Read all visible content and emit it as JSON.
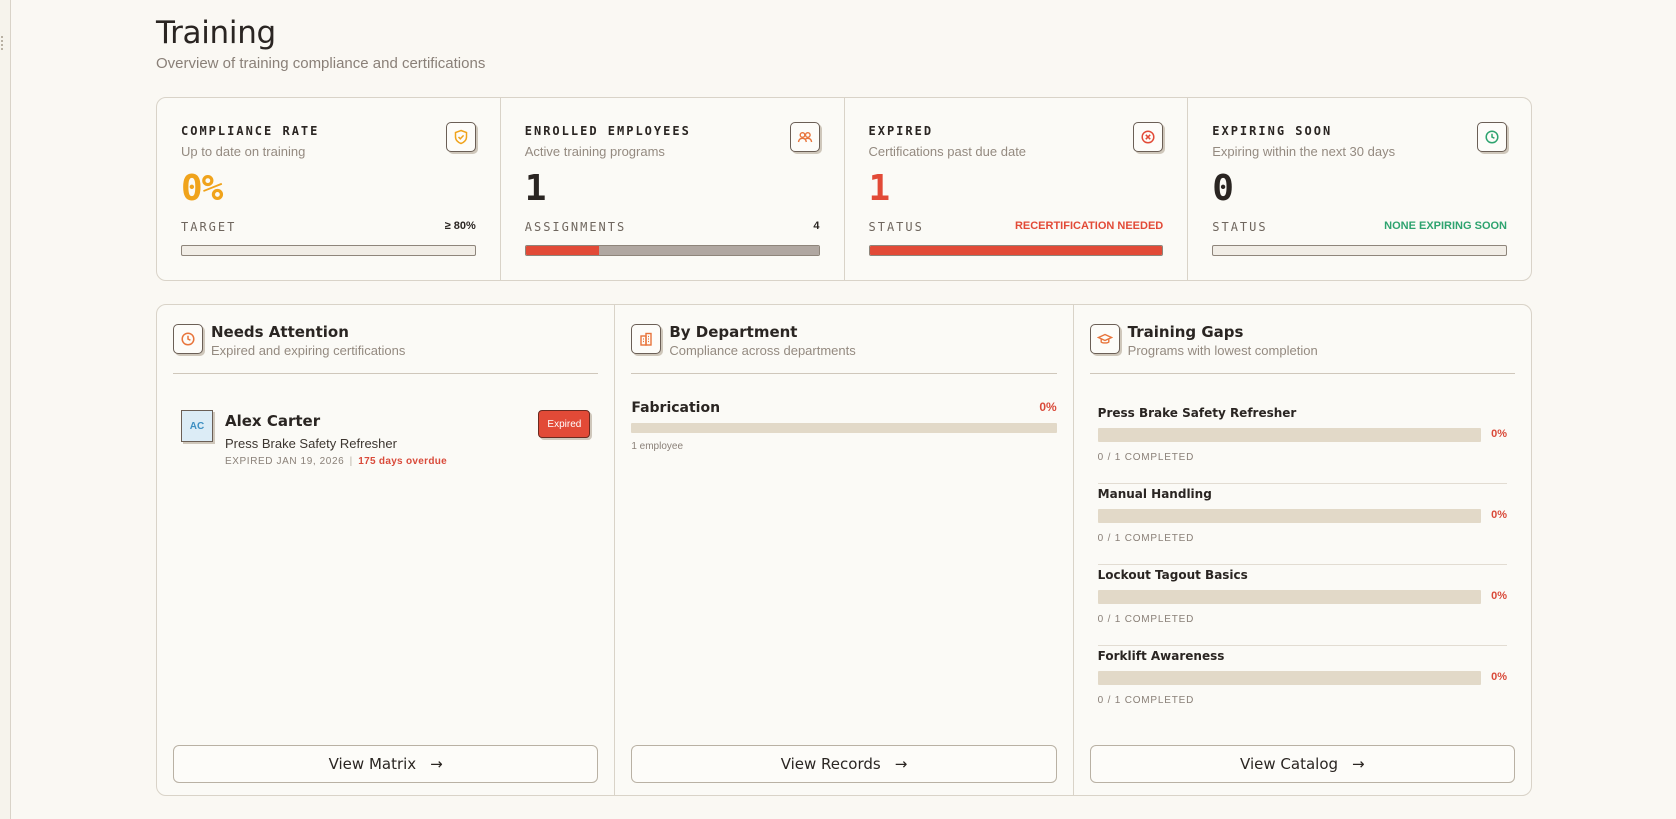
{
  "header": {
    "title": "Training",
    "subtitle": "Overview of training compliance and certifications"
  },
  "stats": [
    {
      "label": "COMPLIANCE RATE",
      "description": "Up to date on training",
      "value": "0%",
      "sublabel": "TARGET",
      "subvalue": "≥ 80%",
      "icon": "shield-check-icon",
      "value_color": "#f0a31b",
      "subvalue_color": "#2a2522",
      "progress": [
        0
      ]
    },
    {
      "label": "ENROLLED EMPLOYEES",
      "description": "Active training programs",
      "value": "1",
      "sublabel": "ASSIGNMENTS",
      "subvalue": "4",
      "icon": "users-icon",
      "value_color": "#2a2522",
      "subvalue_color": "#2a2522",
      "progress": [
        25,
        75
      ]
    },
    {
      "label": "EXPIRED",
      "description": "Certifications past due date",
      "value": "1",
      "sublabel": "STATUS",
      "subvalue": "RECERTIFICATION NEEDED",
      "icon": "x-circle-icon",
      "value_color": "#e24a37",
      "subvalue_color": "#e24a37",
      "progress": [
        100
      ]
    },
    {
      "label": "EXPIRING SOON",
      "description": "Expiring within the next 30 days",
      "value": "0",
      "sublabel": "STATUS",
      "subvalue": "NONE EXPIRING SOON",
      "icon": "clock-icon",
      "value_color": "#2a2522",
      "subvalue_color": "#2ea36f",
      "progress": [
        0
      ]
    }
  ],
  "needs_attention": {
    "title": "Needs Attention",
    "description": "Expired and expiring certifications",
    "icon": "clock-icon",
    "item": {
      "initials": "AC",
      "name": "Alex Carter",
      "program": "Press Brake Safety Refresher",
      "expired_text": "EXPIRED JAN 19, 2026",
      "separator": "|",
      "overdue_text": "175 days overdue",
      "badge": "Expired"
    },
    "button": "View Matrix"
  },
  "by_department": {
    "title": "By Department",
    "description": "Compliance across departments",
    "icon": "building-icon",
    "item": {
      "name": "Fabrication",
      "percent": "0%",
      "count": "1 employee"
    },
    "button": "View Records"
  },
  "training_gaps": {
    "title": "Training Gaps",
    "description": "Programs with lowest completion",
    "icon": "graduation-cap-icon",
    "items": [
      {
        "name": "Press Brake Safety Refresher",
        "percent": "0%",
        "completed": "0 / 1 COMPLETED"
      },
      {
        "name": "Manual Handling",
        "percent": "0%",
        "completed": "0 / 1 COMPLETED"
      },
      {
        "name": "Lockout Tagout Basics",
        "percent": "0%",
        "completed": "0 / 1 COMPLETED"
      },
      {
        "name": "Forklift Awareness",
        "percent": "0%",
        "completed": "0 / 1 COMPLETED"
      }
    ],
    "button": "View Catalog"
  },
  "colors": {
    "accent": "#e8743b",
    "danger": "#e24a37",
    "success": "#2ea36f",
    "warning": "#f0a31b"
  }
}
